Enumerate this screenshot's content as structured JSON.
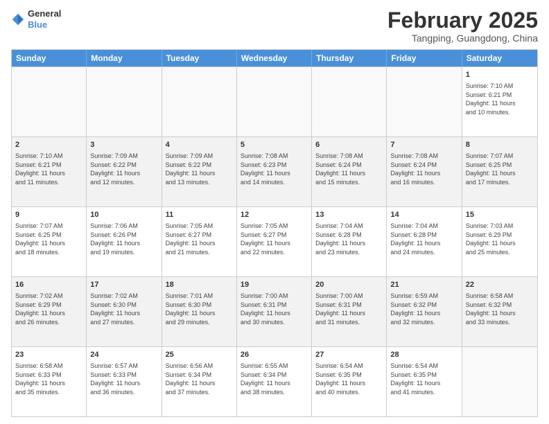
{
  "header": {
    "logo": {
      "line1": "General",
      "line2": "Blue"
    },
    "title": "February 2025",
    "location": "Tangping, Guangdong, China"
  },
  "weekdays": [
    "Sunday",
    "Monday",
    "Tuesday",
    "Wednesday",
    "Thursday",
    "Friday",
    "Saturday"
  ],
  "weeks": [
    [
      {
        "day": "",
        "info": "",
        "empty": true
      },
      {
        "day": "",
        "info": "",
        "empty": true
      },
      {
        "day": "",
        "info": "",
        "empty": true
      },
      {
        "day": "",
        "info": "",
        "empty": true
      },
      {
        "day": "",
        "info": "",
        "empty": true
      },
      {
        "day": "",
        "info": "",
        "empty": true
      },
      {
        "day": "1",
        "info": "Sunrise: 7:10 AM\nSunset: 6:21 PM\nDaylight: 11 hours\nand 10 minutes.",
        "empty": false
      }
    ],
    [
      {
        "day": "2",
        "info": "Sunrise: 7:10 AM\nSunset: 6:21 PM\nDaylight: 11 hours\nand 11 minutes.",
        "empty": false
      },
      {
        "day": "3",
        "info": "Sunrise: 7:09 AM\nSunset: 6:22 PM\nDaylight: 11 hours\nand 12 minutes.",
        "empty": false
      },
      {
        "day": "4",
        "info": "Sunrise: 7:09 AM\nSunset: 6:22 PM\nDaylight: 11 hours\nand 13 minutes.",
        "empty": false
      },
      {
        "day": "5",
        "info": "Sunrise: 7:08 AM\nSunset: 6:23 PM\nDaylight: 11 hours\nand 14 minutes.",
        "empty": false
      },
      {
        "day": "6",
        "info": "Sunrise: 7:08 AM\nSunset: 6:24 PM\nDaylight: 11 hours\nand 15 minutes.",
        "empty": false
      },
      {
        "day": "7",
        "info": "Sunrise: 7:08 AM\nSunset: 6:24 PM\nDaylight: 11 hours\nand 16 minutes.",
        "empty": false
      },
      {
        "day": "8",
        "info": "Sunrise: 7:07 AM\nSunset: 6:25 PM\nDaylight: 11 hours\nand 17 minutes.",
        "empty": false
      }
    ],
    [
      {
        "day": "9",
        "info": "Sunrise: 7:07 AM\nSunset: 6:25 PM\nDaylight: 11 hours\nand 18 minutes.",
        "empty": false
      },
      {
        "day": "10",
        "info": "Sunrise: 7:06 AM\nSunset: 6:26 PM\nDaylight: 11 hours\nand 19 minutes.",
        "empty": false
      },
      {
        "day": "11",
        "info": "Sunrise: 7:05 AM\nSunset: 6:27 PM\nDaylight: 11 hours\nand 21 minutes.",
        "empty": false
      },
      {
        "day": "12",
        "info": "Sunrise: 7:05 AM\nSunset: 6:27 PM\nDaylight: 11 hours\nand 22 minutes.",
        "empty": false
      },
      {
        "day": "13",
        "info": "Sunrise: 7:04 AM\nSunset: 6:28 PM\nDaylight: 11 hours\nand 23 minutes.",
        "empty": false
      },
      {
        "day": "14",
        "info": "Sunrise: 7:04 AM\nSunset: 6:28 PM\nDaylight: 11 hours\nand 24 minutes.",
        "empty": false
      },
      {
        "day": "15",
        "info": "Sunrise: 7:03 AM\nSunset: 6:29 PM\nDaylight: 11 hours\nand 25 minutes.",
        "empty": false
      }
    ],
    [
      {
        "day": "16",
        "info": "Sunrise: 7:02 AM\nSunset: 6:29 PM\nDaylight: 11 hours\nand 26 minutes.",
        "empty": false
      },
      {
        "day": "17",
        "info": "Sunrise: 7:02 AM\nSunset: 6:30 PM\nDaylight: 11 hours\nand 27 minutes.",
        "empty": false
      },
      {
        "day": "18",
        "info": "Sunrise: 7:01 AM\nSunset: 6:30 PM\nDaylight: 11 hours\nand 29 minutes.",
        "empty": false
      },
      {
        "day": "19",
        "info": "Sunrise: 7:00 AM\nSunset: 6:31 PM\nDaylight: 11 hours\nand 30 minutes.",
        "empty": false
      },
      {
        "day": "20",
        "info": "Sunrise: 7:00 AM\nSunset: 6:31 PM\nDaylight: 11 hours\nand 31 minutes.",
        "empty": false
      },
      {
        "day": "21",
        "info": "Sunrise: 6:59 AM\nSunset: 6:32 PM\nDaylight: 11 hours\nand 32 minutes.",
        "empty": false
      },
      {
        "day": "22",
        "info": "Sunrise: 6:58 AM\nSunset: 6:32 PM\nDaylight: 11 hours\nand 33 minutes.",
        "empty": false
      }
    ],
    [
      {
        "day": "23",
        "info": "Sunrise: 6:58 AM\nSunset: 6:33 PM\nDaylight: 11 hours\nand 35 minutes.",
        "empty": false
      },
      {
        "day": "24",
        "info": "Sunrise: 6:57 AM\nSunset: 6:33 PM\nDaylight: 11 hours\nand 36 minutes.",
        "empty": false
      },
      {
        "day": "25",
        "info": "Sunrise: 6:56 AM\nSunset: 6:34 PM\nDaylight: 11 hours\nand 37 minutes.",
        "empty": false
      },
      {
        "day": "26",
        "info": "Sunrise: 6:55 AM\nSunset: 6:34 PM\nDaylight: 11 hours\nand 38 minutes.",
        "empty": false
      },
      {
        "day": "27",
        "info": "Sunrise: 6:54 AM\nSunset: 6:35 PM\nDaylight: 11 hours\nand 40 minutes.",
        "empty": false
      },
      {
        "day": "28",
        "info": "Sunrise: 6:54 AM\nSunset: 6:35 PM\nDaylight: 11 hours\nand 41 minutes.",
        "empty": false
      },
      {
        "day": "",
        "info": "",
        "empty": true
      }
    ]
  ]
}
